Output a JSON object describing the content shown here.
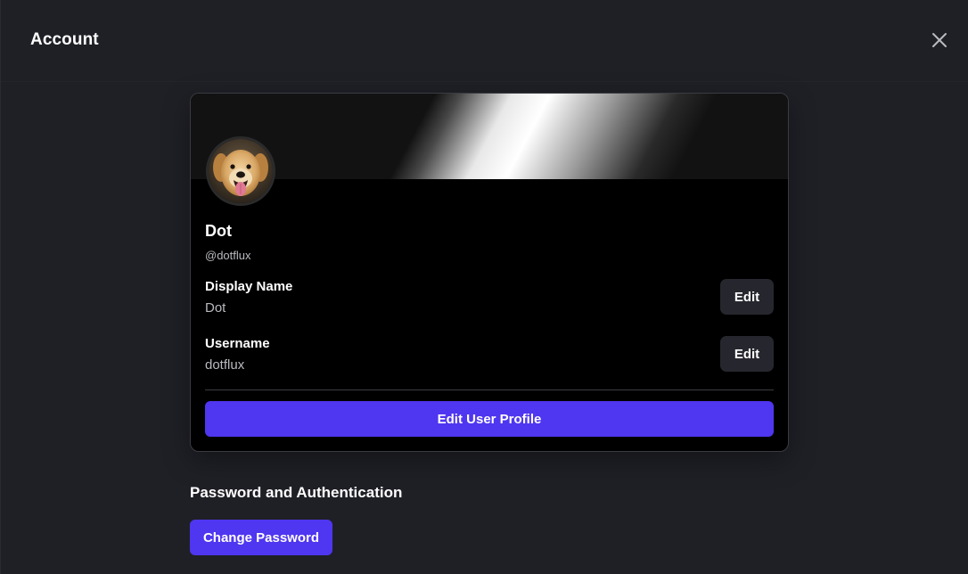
{
  "header": {
    "title": "Account",
    "close_icon": "close-icon"
  },
  "profile": {
    "display_name": "Dot",
    "handle": "@dotflux",
    "avatar_icon": "avatar-dog-photo",
    "fields": {
      "display_name": {
        "label": "Display Name",
        "value": "Dot",
        "edit_label": "Edit"
      },
      "username": {
        "label": "Username",
        "value": "dotflux",
        "edit_label": "Edit"
      }
    },
    "edit_profile_label": "Edit User Profile"
  },
  "password_section": {
    "heading": "Password and Authentication",
    "change_password_label": "Change Password"
  },
  "colors": {
    "background": "#1f2026",
    "card": "#000000",
    "accent": "#4f36f0",
    "secondary_button": "#26272e",
    "muted_text": "#b9bac0"
  }
}
